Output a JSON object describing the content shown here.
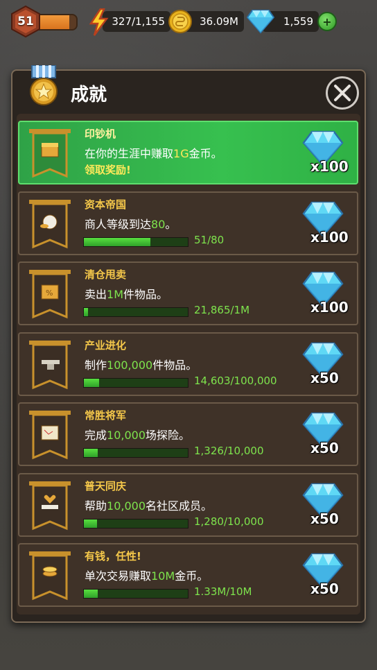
{
  "top_bar": {
    "level": "51",
    "level_progress": 0.82,
    "energy": "327/1,155",
    "gold": "36.09M",
    "gems": "1,559",
    "add_gems_label": "+"
  },
  "panel": {
    "title": "成就"
  },
  "achievements": [
    {
      "title": "印钞机",
      "desc_pre": "在你的生涯中赚取",
      "desc_hl": "1G",
      "desc_post": "金币。",
      "claim_label": "领取奖励!",
      "reward": "x100",
      "claimable": true
    },
    {
      "title": "资本帝国",
      "desc_pre": "商人等级到达",
      "desc_hl": "80",
      "desc_post": "。",
      "progress": "51/80",
      "fill": 0.6375,
      "reward": "x100"
    },
    {
      "title": "清仓甩卖",
      "desc_pre": "卖出",
      "desc_hl": "1M",
      "desc_post": "件物品。",
      "progress": "21,865/1M",
      "fill": 0.03,
      "reward": "x100"
    },
    {
      "title": "产业进化",
      "desc_pre": "制作",
      "desc_hl": "100,000",
      "desc_post": "件物品。",
      "progress": "14,603/100,000",
      "fill": 0.146,
      "reward": "x50"
    },
    {
      "title": "常胜将军",
      "desc_pre": "完成",
      "desc_hl": "10,000",
      "desc_post": "场探险。",
      "progress": "1,326/10,000",
      "fill": 0.1326,
      "reward": "x50"
    },
    {
      "title": "普天同庆",
      "desc_pre": "帮助",
      "desc_hl": "10,000",
      "desc_post": "名社区成员。",
      "progress": "1,280/10,000",
      "fill": 0.128,
      "reward": "x50"
    },
    {
      "title": "有钱，任性!",
      "desc_pre": "单次交易赚取",
      "desc_hl": "10M",
      "desc_post": "金币。",
      "progress": "1.33M/10M",
      "fill": 0.133,
      "reward": "x50"
    }
  ],
  "icons": {
    "level": "shield-badge-icon",
    "energy": "lightning-icon",
    "gold": "coin-icon",
    "gem": "diamond-icon",
    "close": "close-icon",
    "medal": "star-medal-icon",
    "rows": [
      "treasure-chest-icon",
      "money-bag-icon",
      "discount-crate-icon",
      "anvil-icon",
      "treasure-map-icon",
      "heart-hand-icon",
      "coin-stack-icon"
    ]
  },
  "colors": {
    "claim_green": "#37c04f",
    "highlight_green": "#7ee44d",
    "title_gold": "#f5c84a",
    "gem_blue": "#5fd8f5"
  }
}
